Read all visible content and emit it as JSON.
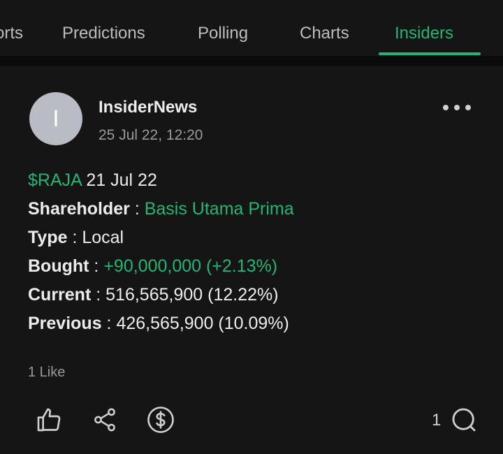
{
  "tabs": [
    {
      "label": "orts",
      "active": false
    },
    {
      "label": "Predictions",
      "active": false
    },
    {
      "label": "Polling",
      "active": false
    },
    {
      "label": "Charts",
      "active": false
    },
    {
      "label": "Insiders",
      "active": true
    }
  ],
  "post": {
    "avatar_letter": "I",
    "username": "InsiderNews",
    "timestamp": "25 Jul 22, 12:20",
    "ticker": "$RAJA",
    "date": "21 Jul 22",
    "fields": [
      {
        "label": "Shareholder",
        "sep": " : ",
        "value": "Basis Utama Prima",
        "highlight": true
      },
      {
        "label": "Type",
        "sep": " : ",
        "value": "Local",
        "highlight": false
      },
      {
        "label": "Bought",
        "sep": " : ",
        "value": "+90,000,000 (+2.13%)",
        "highlight": true
      },
      {
        "label": "Current",
        "sep": " : ",
        "value": "516,565,900 (12.22%)",
        "highlight": false
      },
      {
        "label": "Previous",
        "sep": " : ",
        "value": "426,565,900 (10.09%)",
        "highlight": false
      }
    ],
    "likes": "1 Like",
    "comment_count": "1"
  },
  "icons": {
    "like": "thumbs-up-icon",
    "share": "share-icon",
    "tip": "dollar-circle-icon",
    "comment": "comment-icon",
    "more": "more-horizontal-icon"
  },
  "colors": {
    "accent": "#22b573",
    "background": "#151515",
    "avatar": "#b9bcc3"
  }
}
